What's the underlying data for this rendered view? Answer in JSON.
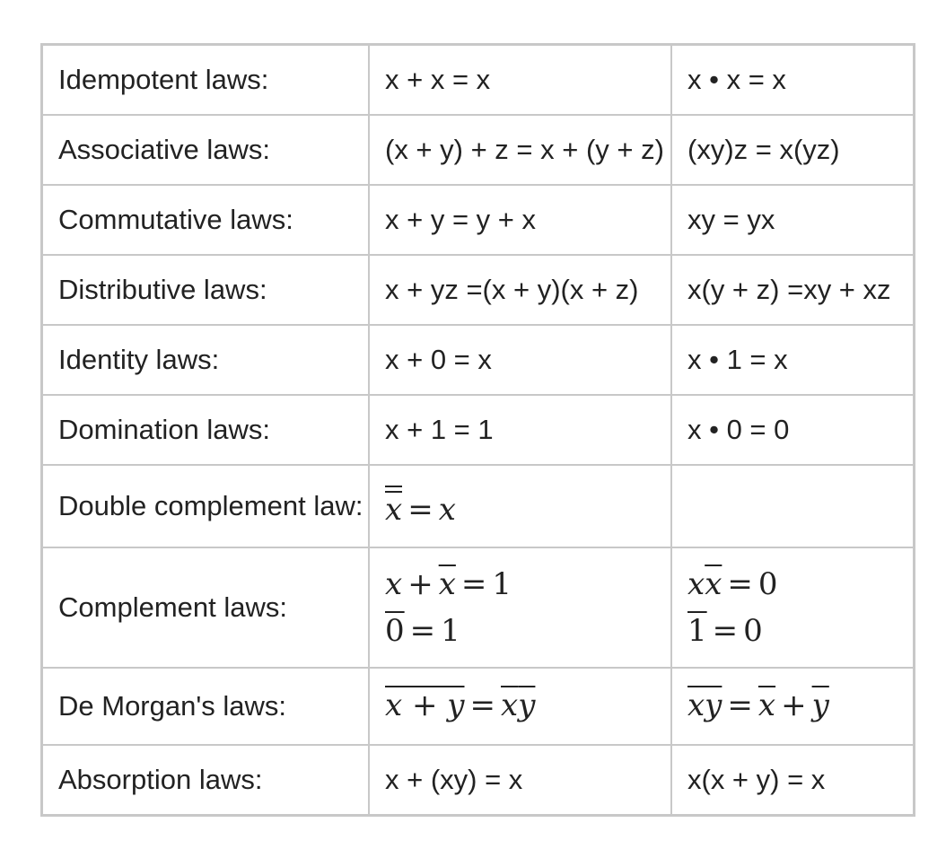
{
  "rows": [
    {
      "name": "Idempotent laws:",
      "left": "x + x = x",
      "right": "x • x = x"
    },
    {
      "name": "Associative laws:",
      "left": "(x + y) + z = x + (y + z)",
      "right": "(xy)z = x(yz)"
    },
    {
      "name": "Commutative laws:",
      "left": "x + y = y + x",
      "right": "xy = yx"
    },
    {
      "name": "Distributive laws:",
      "left": "x + yz =(x + y)(x + z)",
      "right": "x(y + z) =xy + xz"
    },
    {
      "name": "Identity laws:",
      "left": "x + 0 = x",
      "right": "x • 1 = x"
    },
    {
      "name": "Domination laws:",
      "left": "x + 1 = 1",
      "right": "x • 0 = 0"
    },
    {
      "name": "Double complement law:",
      "left": {
        "x": "x",
        "eq": "=",
        "rhs": "x"
      },
      "right": ""
    },
    {
      "name": "Complement laws:",
      "left": {
        "l1": {
          "x": "x",
          "plus": "+",
          "xbar": "x",
          "eq": "=",
          "rhs": "1"
        },
        "l2": {
          "zero": "0",
          "eq": "=",
          "rhs": "1"
        }
      },
      "right": {
        "l1": {
          "x": "x",
          "xbar": "x",
          "eq": "=",
          "rhs": "0"
        },
        "l2": {
          "one": "1",
          "eq": "=",
          "rhs": "0"
        }
      }
    },
    {
      "name": "De Morgan's laws:",
      "left": {
        "lhs": "x + y",
        "eq": "=",
        "x": "x",
        "y": "y"
      },
      "right": {
        "lhs": "xy",
        "eq": "=",
        "x": "x",
        "plus": "+",
        "y": "y"
      }
    },
    {
      "name": "Absorption laws:",
      "left": "x + (xy) = x",
      "right": "x(x + y) = x"
    }
  ]
}
